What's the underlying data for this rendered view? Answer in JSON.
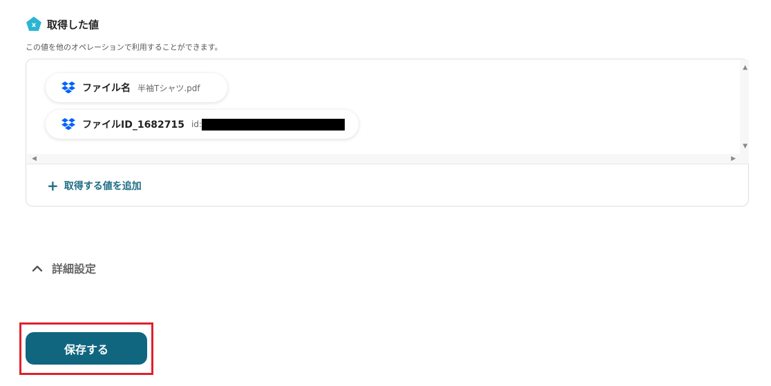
{
  "section": {
    "title": "取得した値",
    "icon": "x-pentagon-icon",
    "description": "この値を他のオペレーションで利用することができます。"
  },
  "values": [
    {
      "name": "ファイル名",
      "value": "半袖Tシャツ.pdf",
      "icon": "dropbox-icon"
    },
    {
      "name": "ファイルID_1682715",
      "value": "id:",
      "redacted": true,
      "icon": "dropbox-icon"
    }
  ],
  "add_value_label": "取得する値を追加",
  "advanced_settings_label": "詳細設定",
  "save_label": "保存する",
  "colors": {
    "accent": "#11667f",
    "link": "#1e6d84",
    "highlight": "#e0202a",
    "icon_badge": "#2bb4d4",
    "dropbox": "#0061fe"
  }
}
